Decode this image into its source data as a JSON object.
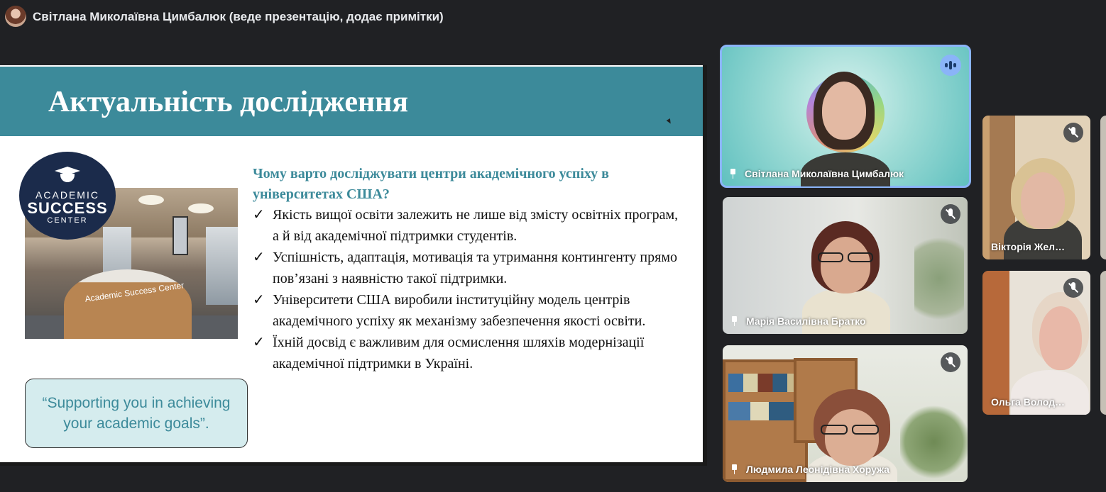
{
  "meeting": {
    "presenter_banner": "Світлана Миколаївна Цимбалюк (веде презентацію, додає примітки)"
  },
  "slide": {
    "title": "Актуальність дослідження",
    "logo": {
      "line1": "ACADEMIC",
      "line2": "SUCCESS",
      "line3": "CENTER"
    },
    "photo_sign": "Academic Success Center",
    "quote": "“Supporting you in achieving your academic goals”.",
    "question": "Чому варто досліджувати центри академічного успіху в університетах США?",
    "bullets": [
      "Якість вищої освіти залежить не лише від змісту освітніх програм, а й від академічної підтримки студентів.",
      "Успішність, адаптація, мотивація та утримання контингенту прямо пов’язані з наявністю такої підтримки.",
      "Університети США виробили інституційну модель центрів академічного успіху як механізму забезпечення якості освіти.",
      "Їхній досвід є важливим для осмислення шляхів модернізації академічної підтримки в Україні."
    ],
    "check_mark": "✓"
  },
  "participants": [
    {
      "name": "Світлана Миколаївна Цимбалюк",
      "status": "speaking"
    },
    {
      "name": "Марія Василівна Братко",
      "status": "muted"
    },
    {
      "name": "Людмила Леонідівна Хоружа",
      "status": "muted"
    },
    {
      "name": "Вікторія Жел…",
      "status": "muted"
    },
    {
      "name": "Ольга Волод…",
      "status": "muted"
    }
  ],
  "colors": {
    "slide_accent": "#3c8a9a",
    "active_tile_border": "#8ab4f8",
    "background": "#202124"
  }
}
